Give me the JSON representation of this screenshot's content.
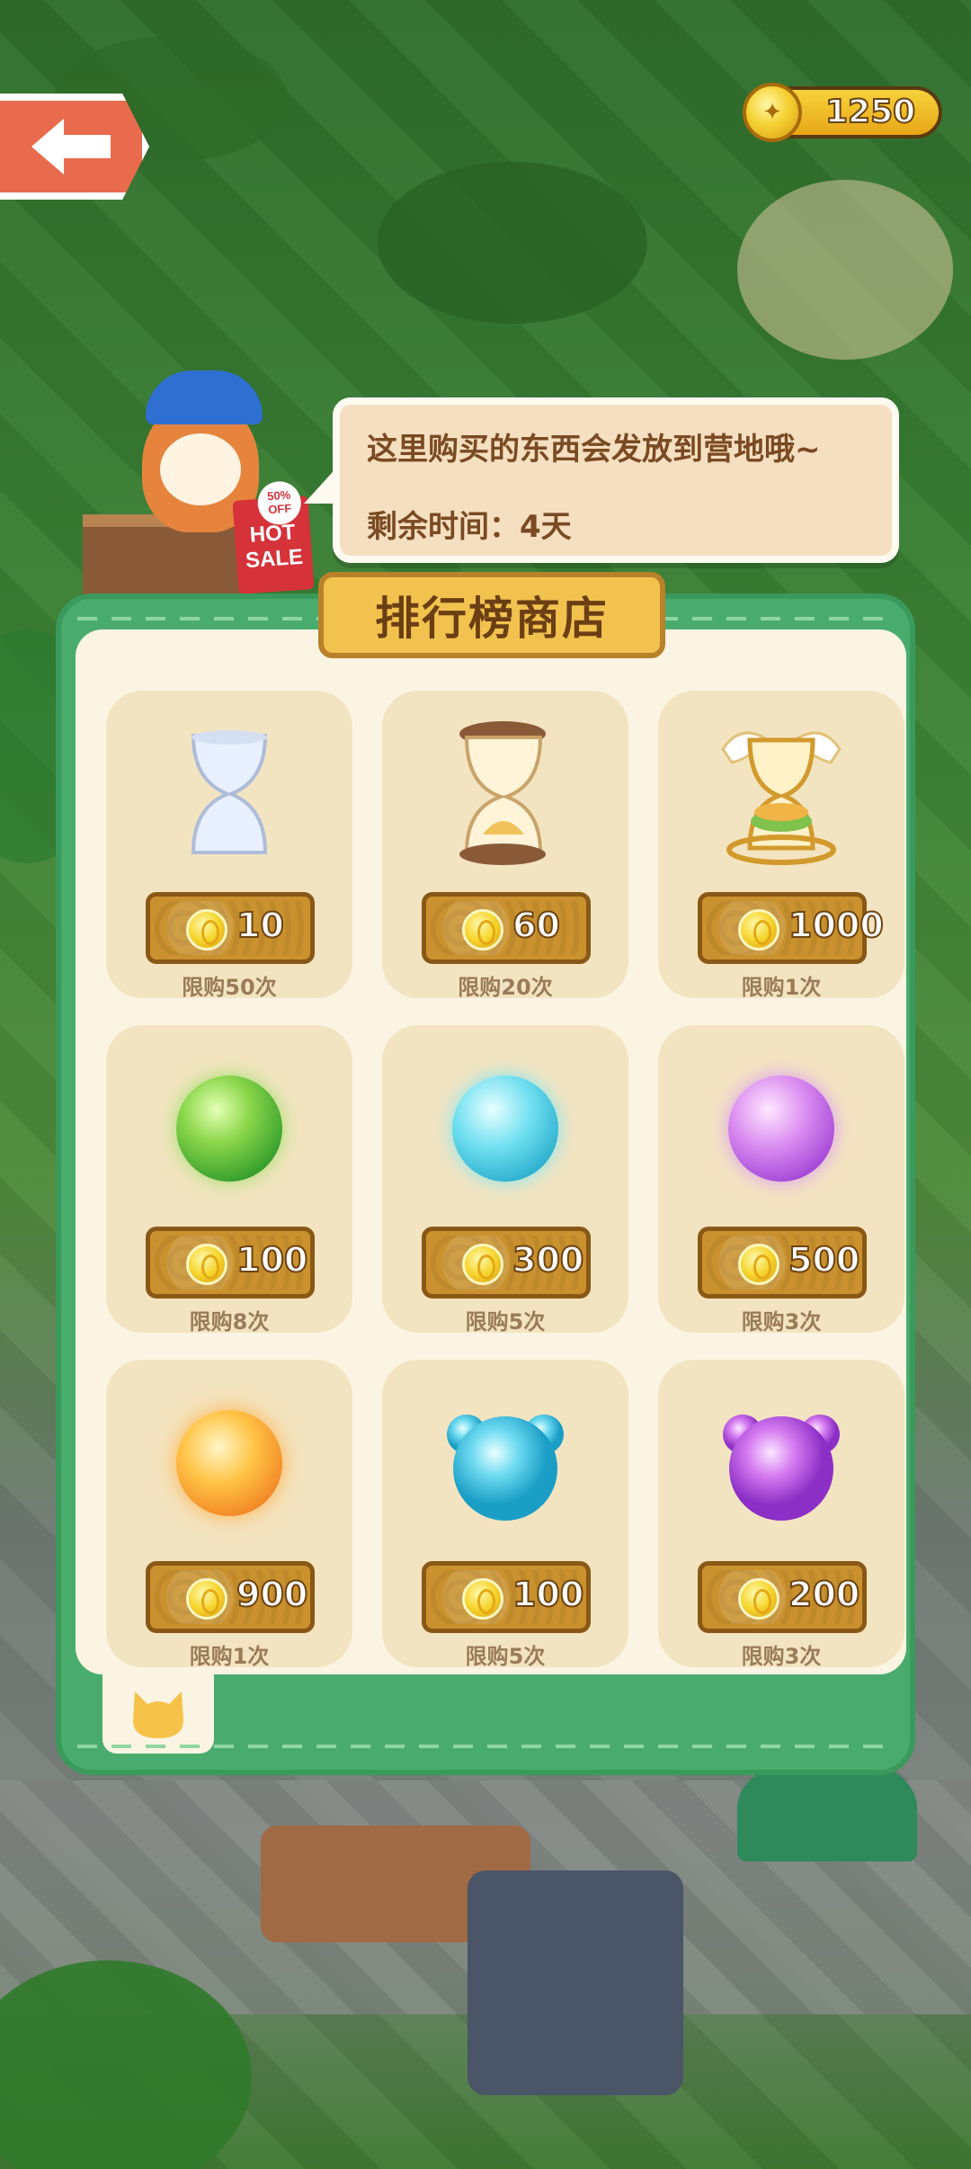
{
  "header": {
    "coin_balance": "1250"
  },
  "npc": {
    "hot_sign_text": "HOT SALE",
    "hot_badge_text": "50% OFF"
  },
  "bubble": {
    "line1": "这里购买的东西会发放到营地哦~",
    "line2": "剩余时间：4天"
  },
  "shop": {
    "title": "排行榜商店",
    "items": [
      {
        "icon": "hourglass-small-icon",
        "price": "10",
        "limit": "限购50次"
      },
      {
        "icon": "hourglass-medium-icon",
        "price": "60",
        "limit": "限购20次"
      },
      {
        "icon": "hourglass-winged-icon",
        "price": "1000",
        "limit": "限购1次"
      },
      {
        "icon": "green-orb-icon",
        "price": "100",
        "limit": "限购8次"
      },
      {
        "icon": "cyan-orb-icon",
        "price": "300",
        "limit": "限购5次"
      },
      {
        "icon": "purple-orb-icon",
        "price": "500",
        "limit": "限购3次"
      },
      {
        "icon": "fire-orb-icon",
        "price": "900",
        "limit": "限购1次"
      },
      {
        "icon": "blue-bear-orb-icon",
        "price": "100",
        "limit": "限购5次"
      },
      {
        "icon": "purple-bear-orb-icon",
        "price": "200",
        "limit": "限购3次"
      }
    ],
    "tabs": [
      {
        "icon": "cat-head-icon"
      }
    ]
  },
  "colors": {
    "panel_green": "#49ac6e",
    "card_bg": "#f3e4c1",
    "price_button": "#c9922e",
    "title_plate": "#f2c24f"
  }
}
